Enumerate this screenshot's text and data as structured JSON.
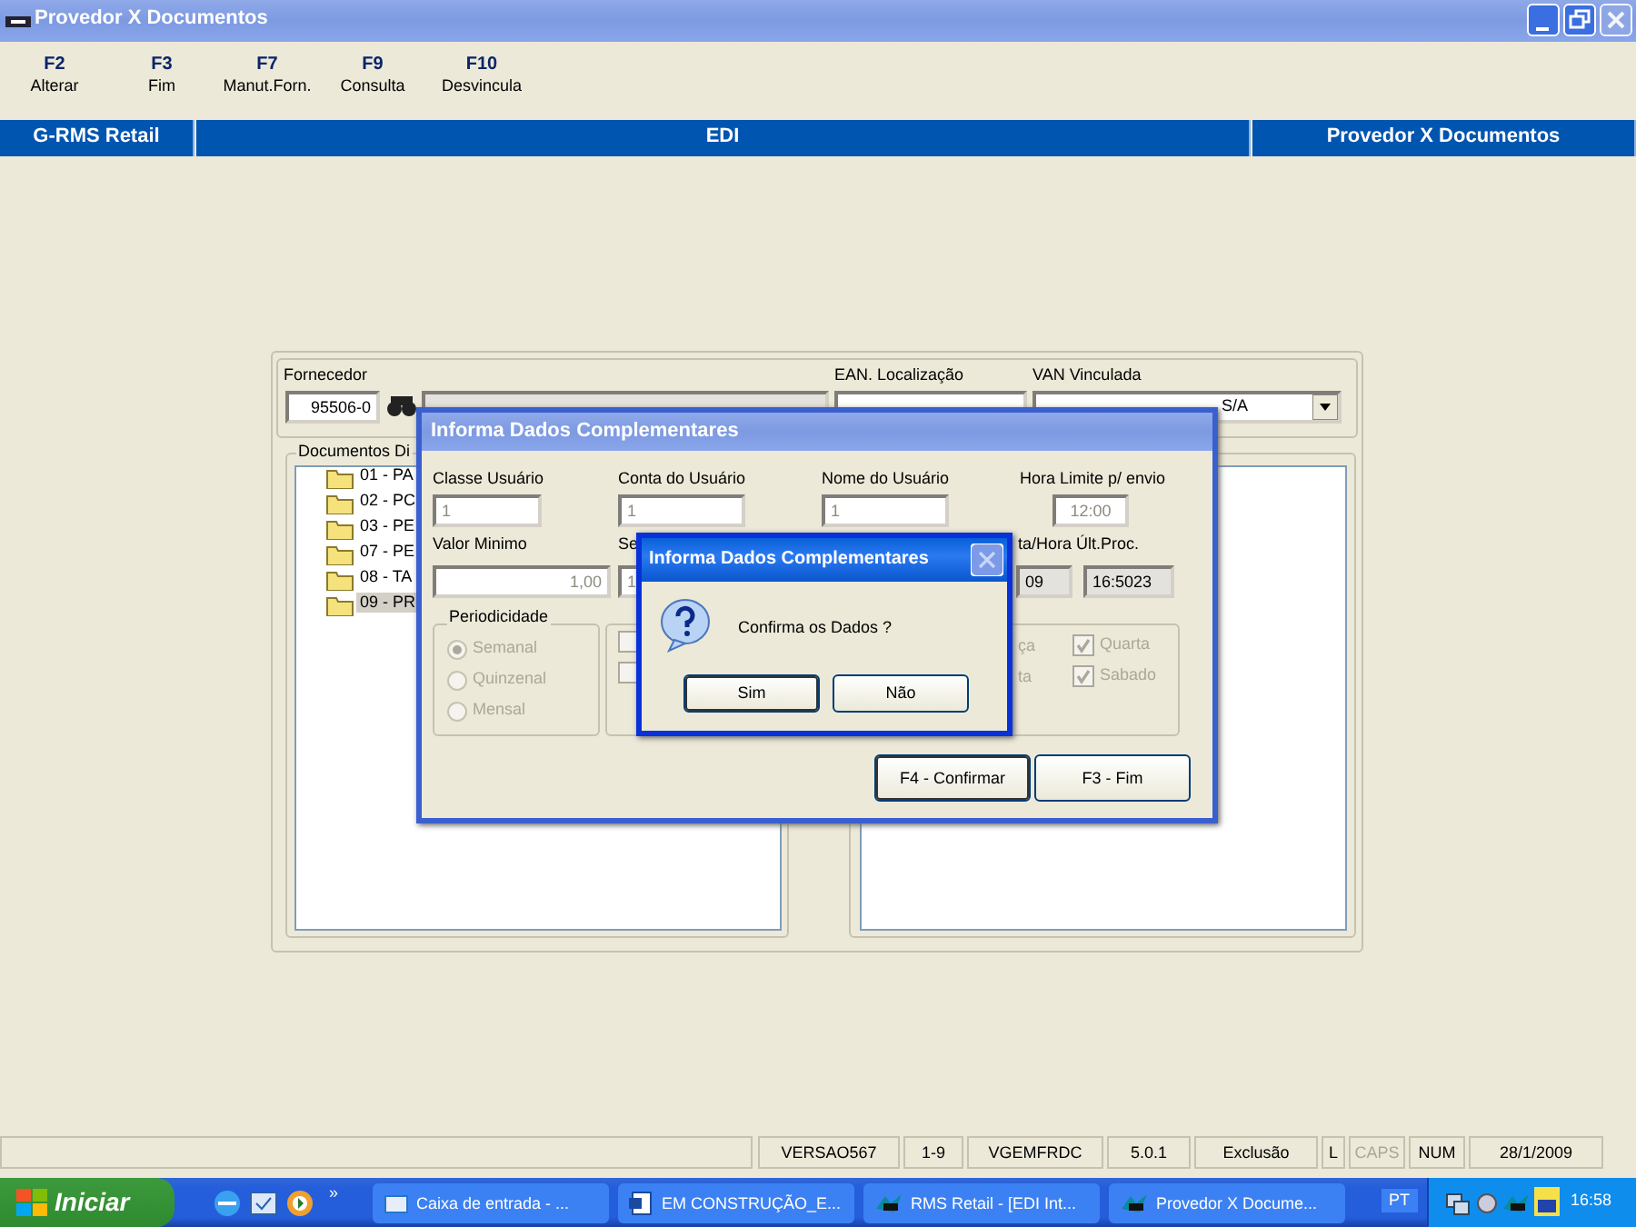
{
  "window": {
    "title": "Provedor X Documentos",
    "controls": [
      {
        "kind": "minimize",
        "disabled": false
      },
      {
        "kind": "restore",
        "disabled": false
      },
      {
        "kind": "close",
        "disabled": true
      }
    ]
  },
  "function_keys": [
    {
      "key": "F2",
      "label": "Alterar"
    },
    {
      "key": "F3",
      "label": "Fim"
    },
    {
      "key": "F7",
      "label": "Manut.Forn."
    },
    {
      "key": "F9",
      "label": "Consulta"
    },
    {
      "key": "F10",
      "label": "Desvincula"
    }
  ],
  "header_bar": [
    "G-RMS Retail",
    "EDI",
    "Provedor X Documentos"
  ],
  "form": {
    "fornecedor_label": "Fornecedor",
    "fornecedor_code": "95506-0",
    "ean_label": "EAN. Localização",
    "van_label": "VAN Vinculada",
    "van_value": "S/A",
    "documents_label": "Documentos Di",
    "documents": [
      {
        "label": "01 - PA",
        "selected": false
      },
      {
        "label": "02 - PC",
        "selected": false
      },
      {
        "label": "03 - PE",
        "selected": false
      },
      {
        "label": "07 - PE",
        "selected": false
      },
      {
        "label": "08 - TA",
        "selected": false
      },
      {
        "label": "09 - PR",
        "selected": true
      }
    ]
  },
  "dialog": {
    "title": "Informa Dados Complementares",
    "fields": [
      {
        "label": "Classe Usuário",
        "value": "1",
        "readonly": false
      },
      {
        "label": "Conta do Usuário",
        "value": "1",
        "readonly": false
      },
      {
        "label": "Nome do Usuário",
        "value": "1",
        "readonly": false
      },
      {
        "label": "Hora Limite p/ envio",
        "value": "12:00",
        "readonly": false
      },
      {
        "label": "Valor Minimo",
        "value": "1,00",
        "readonly": false
      },
      {
        "label": "Se",
        "value": "1",
        "readonly": false
      },
      {
        "label": "ta/Hora Últ.Proc.",
        "value": "09",
        "readonly": true
      },
      {
        "value": "16:5023",
        "readonly": true
      }
    ],
    "periodicity_label": "Periodicidade",
    "periodicity": [
      {
        "label": "Semanal",
        "selected": true
      },
      {
        "label": "Quinzenal",
        "selected": false
      },
      {
        "label": "Mensal",
        "selected": false
      }
    ],
    "middle_checks": [
      {
        "checked": false
      },
      {
        "checked": false
      }
    ],
    "day_fragments": [
      "ça",
      "ta"
    ],
    "days": [
      {
        "label": "Quarta",
        "checked": true
      },
      {
        "label": "Sabado",
        "checked": true
      }
    ],
    "buttons": [
      {
        "label": "F4 - Confirmar",
        "default": true
      },
      {
        "label": "F3 - Fim",
        "default": false
      }
    ]
  },
  "confirm": {
    "title": "Informa Dados Complementares",
    "message": "Confirma os Dados ?",
    "buttons": [
      {
        "label": "Sim",
        "default": true
      },
      {
        "label": "Não",
        "default": false
      }
    ]
  },
  "status_bar": [
    {
      "text": "VERSAO567",
      "enabled": true
    },
    {
      "text": "1-9",
      "enabled": true
    },
    {
      "text": "VGEMFRDC",
      "enabled": true
    },
    {
      "text": "5.0.1",
      "enabled": true
    },
    {
      "text": "Exclusão",
      "enabled": true
    },
    {
      "text": "L",
      "enabled": true
    },
    {
      "text": "CAPS",
      "enabled": false
    },
    {
      "text": "NUM",
      "enabled": true
    },
    {
      "text": "28/1/2009",
      "enabled": true
    }
  ],
  "taskbar": {
    "start": "Iniciar",
    "more": "»",
    "tasks": [
      {
        "label": "Caixa de entrada - ...",
        "kind": "mail"
      },
      {
        "label": "EM CONSTRUÇÃO_E...",
        "kind": "word"
      },
      {
        "label": "RMS Retail - [EDI Int...",
        "kind": "rms"
      },
      {
        "label": "Provedor X Docume...",
        "kind": "rms"
      }
    ],
    "language": "PT",
    "time": "16:58"
  }
}
